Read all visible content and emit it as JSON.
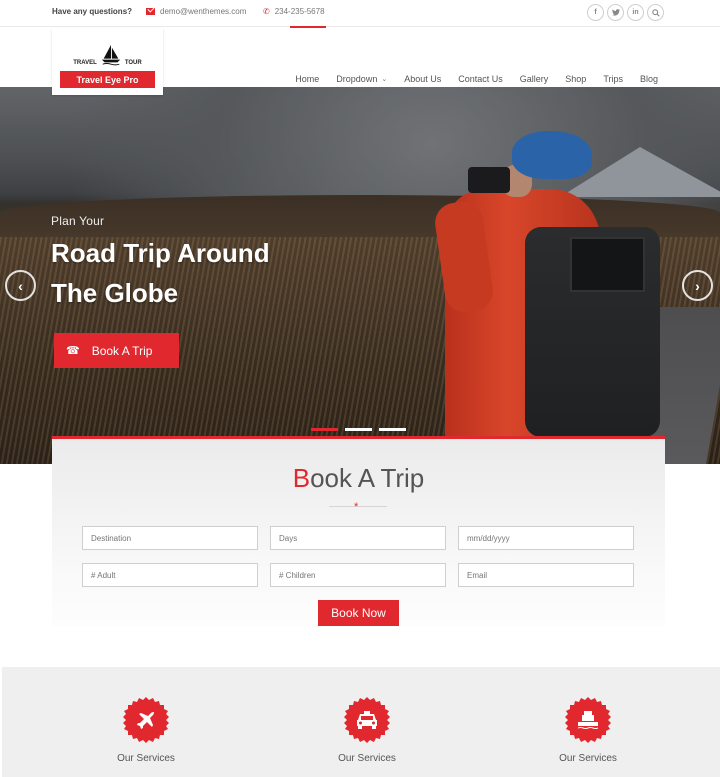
{
  "topbar": {
    "question": "Have any questions?",
    "email": "demo@wenthemes.com",
    "phone": "234-235-5678",
    "social": [
      {
        "icon": "facebook-icon",
        "glyph": "f"
      },
      {
        "icon": "twitter-icon",
        "glyph": "t"
      },
      {
        "icon": "linkedin-icon",
        "glyph": "in"
      },
      {
        "icon": "search-icon",
        "glyph": "⌕"
      }
    ]
  },
  "logo": {
    "left_word": "TRAVEL",
    "right_word": "TOUR",
    "band_text": "Travel Eye Pro"
  },
  "nav": {
    "items": [
      {
        "label": "Home",
        "active": true
      },
      {
        "label": "Dropdown",
        "has_dropdown": true
      },
      {
        "label": "About Us"
      },
      {
        "label": "Contact Us"
      },
      {
        "label": "Gallery"
      },
      {
        "label": "Shop"
      },
      {
        "label": "Trips"
      },
      {
        "label": "Blog"
      }
    ],
    "dropdown_glyph": "⌄"
  },
  "hero": {
    "subtitle": "Plan Your",
    "title": "Road Trip Around The Globe",
    "button_label": "Book A Trip",
    "button_icon": "☎",
    "prev_glyph": "‹",
    "next_glyph": "›",
    "slides_total": 3,
    "active_slide": 1
  },
  "booking": {
    "title_first": "B",
    "title_rest": "ook A Trip",
    "divider_glyph": "*",
    "fields": {
      "destination": {
        "placeholder": "Destination",
        "value": ""
      },
      "days": {
        "placeholder": "Days",
        "value": ""
      },
      "date": {
        "placeholder": "mm/dd/yyyy",
        "value": ""
      },
      "adult": {
        "placeholder": "# Adult",
        "value": ""
      },
      "children": {
        "placeholder": "# Children",
        "value": ""
      },
      "email": {
        "placeholder": "Email",
        "value": ""
      }
    },
    "submit_label": "Book Now"
  },
  "services": {
    "items": [
      {
        "label": "Our Services",
        "icon": "plane-icon"
      },
      {
        "label": "Our Services",
        "icon": "taxi-icon"
      },
      {
        "label": "Our Services",
        "icon": "ship-icon"
      }
    ]
  },
  "colors": {
    "accent": "#e0282e",
    "services_bg": "#efefef"
  }
}
